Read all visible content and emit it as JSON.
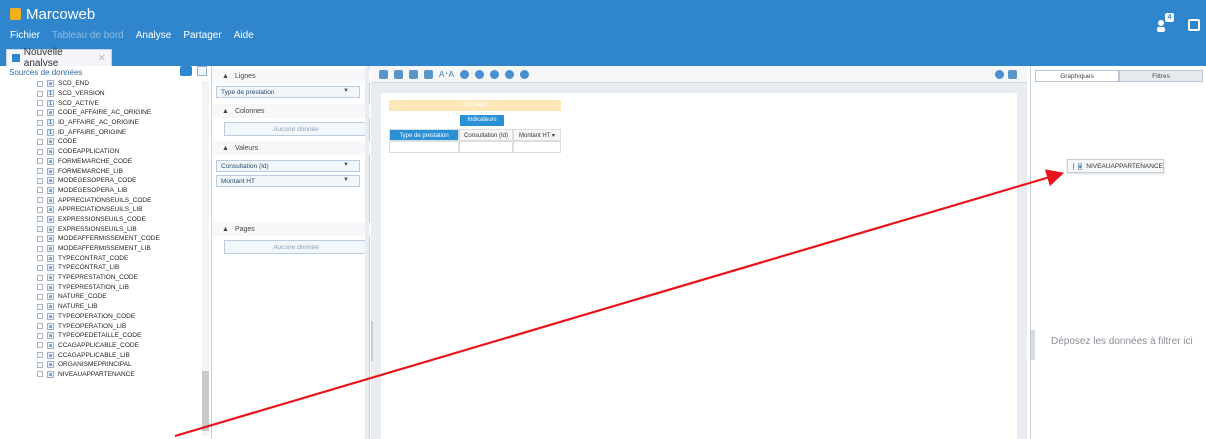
{
  "app": {
    "title": "Marcoweb"
  },
  "menu": [
    {
      "label": "Fichier",
      "enabled": true
    },
    {
      "label": "Tableau de bord",
      "enabled": false
    },
    {
      "label": "Analyse",
      "enabled": true
    },
    {
      "label": "Partager",
      "enabled": true
    },
    {
      "label": "Aide",
      "enabled": true
    }
  ],
  "header": {
    "notification_badge": "4"
  },
  "tabs": [
    {
      "label": "Nouvelle analyse"
    }
  ],
  "sources": {
    "title": "Sources de données",
    "items": [
      {
        "type": "a",
        "label": "SCD_END"
      },
      {
        "type": "1",
        "label": "SCD_VERSION"
      },
      {
        "type": "1",
        "label": "SCD_ACTIVE"
      },
      {
        "type": "a",
        "label": "CODE_AFFAIRE_AC_ORIGINE"
      },
      {
        "type": "1",
        "label": "ID_AFFAIRE_AC_ORIGINE"
      },
      {
        "type": "1",
        "label": "ID_AFFAIRE_ORIGINE"
      },
      {
        "type": "a",
        "label": "CODE"
      },
      {
        "type": "a",
        "label": "CODEAPPLICATION"
      },
      {
        "type": "a",
        "label": "FORMEMARCHE_CODE"
      },
      {
        "type": "a",
        "label": "FORMEMARCHE_LIB"
      },
      {
        "type": "a",
        "label": "MODEGESOPERA_CODE"
      },
      {
        "type": "a",
        "label": "MODEGESOPERA_LIB"
      },
      {
        "type": "a",
        "label": "APPRECIATIONSEUILS_CODE"
      },
      {
        "type": "a",
        "label": "APPRECIATIONSEUILS_LIB"
      },
      {
        "type": "a",
        "label": "EXPRESSIONSEUILS_CODE"
      },
      {
        "type": "a",
        "label": "EXPRESSIONSEUILS_LIB"
      },
      {
        "type": "a",
        "label": "MODEAFFERMISSEMENT_CODE"
      },
      {
        "type": "a",
        "label": "MODEAFFERMISSEMENT_LIB"
      },
      {
        "type": "a",
        "label": "TYPECONTRAT_CODE"
      },
      {
        "type": "a",
        "label": "TYPECONTRAT_LIB"
      },
      {
        "type": "a",
        "label": "TYPEPRESTATION_CODE"
      },
      {
        "type": "a",
        "label": "TYPEPRESTATION_LIB"
      },
      {
        "type": "a",
        "label": "NATURE_CODE"
      },
      {
        "type": "a",
        "label": "NATURE_LIB"
      },
      {
        "type": "a",
        "label": "TYPEOPERATION_CODE"
      },
      {
        "type": "a",
        "label": "TYPEOPERATION_LIB"
      },
      {
        "type": "a",
        "label": "TYPEOPEDETAILLE_CODE"
      },
      {
        "type": "a",
        "label": "CCAGAPPLICABLE_CODE"
      },
      {
        "type": "a",
        "label": "CCAGAPPLICABLE_LIB"
      },
      {
        "type": "a",
        "label": "ORGANISMEPRINCIPAL"
      },
      {
        "type": "a",
        "label": "NIVEAUAPPARTENANCE"
      }
    ]
  },
  "config": {
    "lignes": {
      "title": "Lignes",
      "fields": [
        "Type de prestation"
      ]
    },
    "colonnes": {
      "title": "Colonnes",
      "empty_text": "Aucune donnée"
    },
    "valeurs": {
      "title": "Valeurs",
      "fields": [
        "Consultation (Id)",
        "Montant HT"
      ]
    },
    "pages": {
      "title": "Pages",
      "empty_text": "Aucune donnée"
    }
  },
  "pivot": {
    "page_label": "Ebj page",
    "indicators_label": "Indicateurs",
    "row_header": "Type de prestation",
    "columns": [
      "Consultation (Id)",
      "Montant HT ▾"
    ]
  },
  "right_panel": {
    "tabs": [
      {
        "label": "Graphiques",
        "active": false
      },
      {
        "label": "Filtres",
        "active": true
      }
    ],
    "chip_label": "NIVEAUAPPARTENANCE",
    "drop_hint": "Déposez les données à filtrer ici"
  },
  "colors": {
    "header": "#2f86cd",
    "accent": "#2a91d6",
    "arrow": "#e8141c",
    "page_band": "#fde6b7"
  }
}
